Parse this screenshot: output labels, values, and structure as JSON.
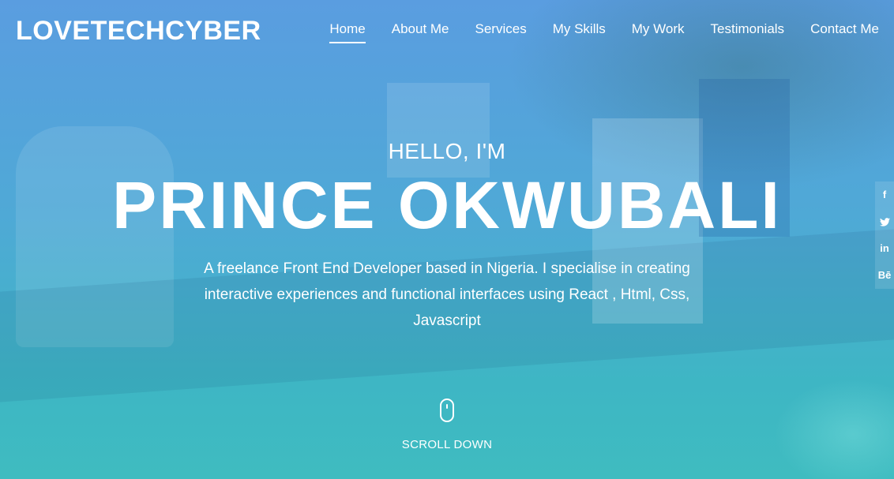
{
  "brand": "LOVETECHCYBER",
  "nav": {
    "items": [
      {
        "label": "Home"
      },
      {
        "label": "About Me"
      },
      {
        "label": "Services"
      },
      {
        "label": "My Skills"
      },
      {
        "label": "My Work"
      },
      {
        "label": "Testimonials"
      },
      {
        "label": "Contact Me"
      }
    ],
    "active": "Home"
  },
  "hero": {
    "greeting": "HELLO, I'M",
    "name": "PRINCE OKWUBALI",
    "description_line1": "A freelance Front End Developer based in Nigeria. I specialise in creating",
    "description_line2": "interactive experiences and functional interfaces using React , Html, Css,",
    "description_line3": "Javascript",
    "scroll_label": "SCROLL DOWN"
  },
  "social": {
    "items": [
      {
        "icon": "facebook-icon",
        "glyph": "f"
      },
      {
        "icon": "twitter-icon",
        "glyph": "🐦"
      },
      {
        "icon": "linkedin-icon",
        "glyph": "in"
      },
      {
        "icon": "behance-icon",
        "glyph": "Bē"
      }
    ]
  },
  "colors": {
    "gradient_top": "#5a9de0",
    "gradient_bottom": "#3fbcc0",
    "text": "#ffffff"
  }
}
